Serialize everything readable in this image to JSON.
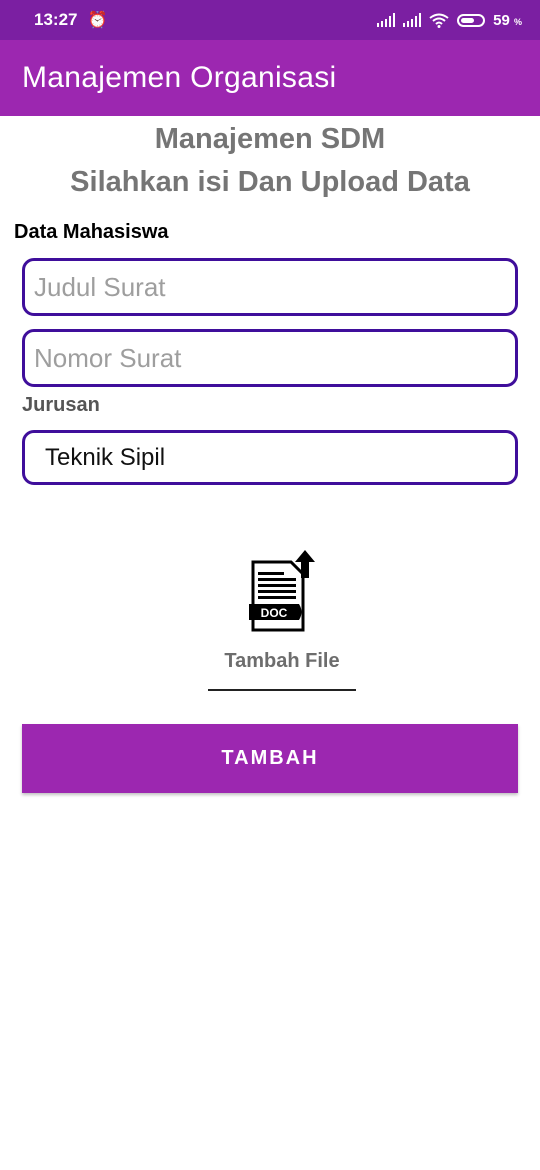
{
  "status_bar": {
    "time": "13:27",
    "battery": "59",
    "battery_unit": "%"
  },
  "app_bar": {
    "title": "Manajemen Organisasi"
  },
  "heading": {
    "line1": "Manajemen SDM",
    "line2": "Silahkan isi Dan Upload Data"
  },
  "form": {
    "section_label": "Data Mahasiswa",
    "judul_placeholder": "Judul Surat",
    "nomor_placeholder": "Nomor Surat",
    "jurusan_label": "Jurusan",
    "jurusan_value": "Teknik Sipil"
  },
  "upload": {
    "doc_label": "DOC",
    "label": "Tambah File"
  },
  "submit": {
    "label": "TAMBAH"
  },
  "colors": {
    "status_bar": "#7b1fa2",
    "primary": "#9c27b0",
    "field_border": "#3f0e9b"
  },
  "icons": [
    "alarm-icon",
    "signal-icon",
    "wifi-icon",
    "battery-icon",
    "doc-upload-icon"
  ]
}
